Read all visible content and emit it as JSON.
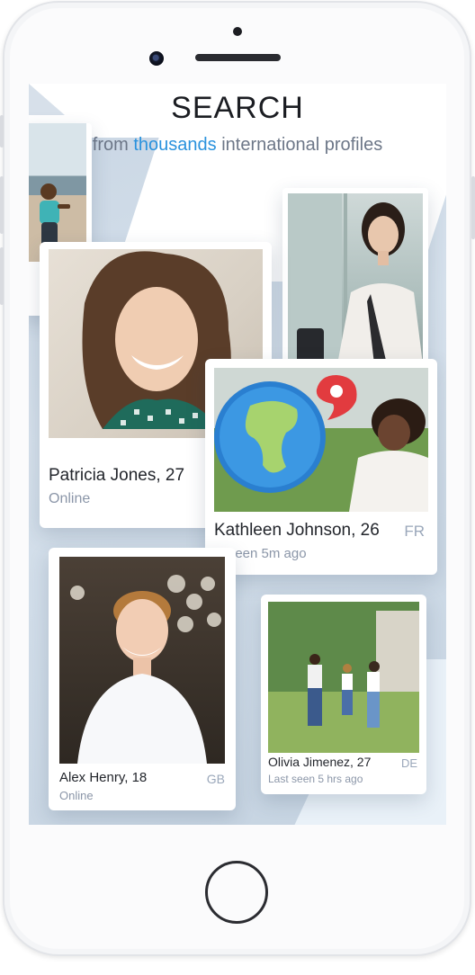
{
  "header": {
    "title": "SEARCH",
    "subtitle_pre": "from ",
    "subtitle_accent": "thousands",
    "subtitle_post": " international profiles"
  },
  "profiles": [
    {
      "name": "Patricia Jones, 27",
      "status": "Online",
      "country": ""
    },
    {
      "name": "Kathleen Johnson, 26",
      "status": "st seen 5m ago",
      "country": "FR"
    },
    {
      "name": "Alex Henry, 18",
      "status": "Online",
      "country": "GB"
    },
    {
      "name": "Olivia Jimenez, 27",
      "status": "Last seen 5 hrs ago",
      "country": "DE"
    }
  ],
  "colors": {
    "accent": "#2a92dd",
    "text": "#23262c",
    "muted": "#8b96a8"
  },
  "icons": {
    "globe": "globe-icon",
    "location_pin": "location-pin-icon"
  }
}
